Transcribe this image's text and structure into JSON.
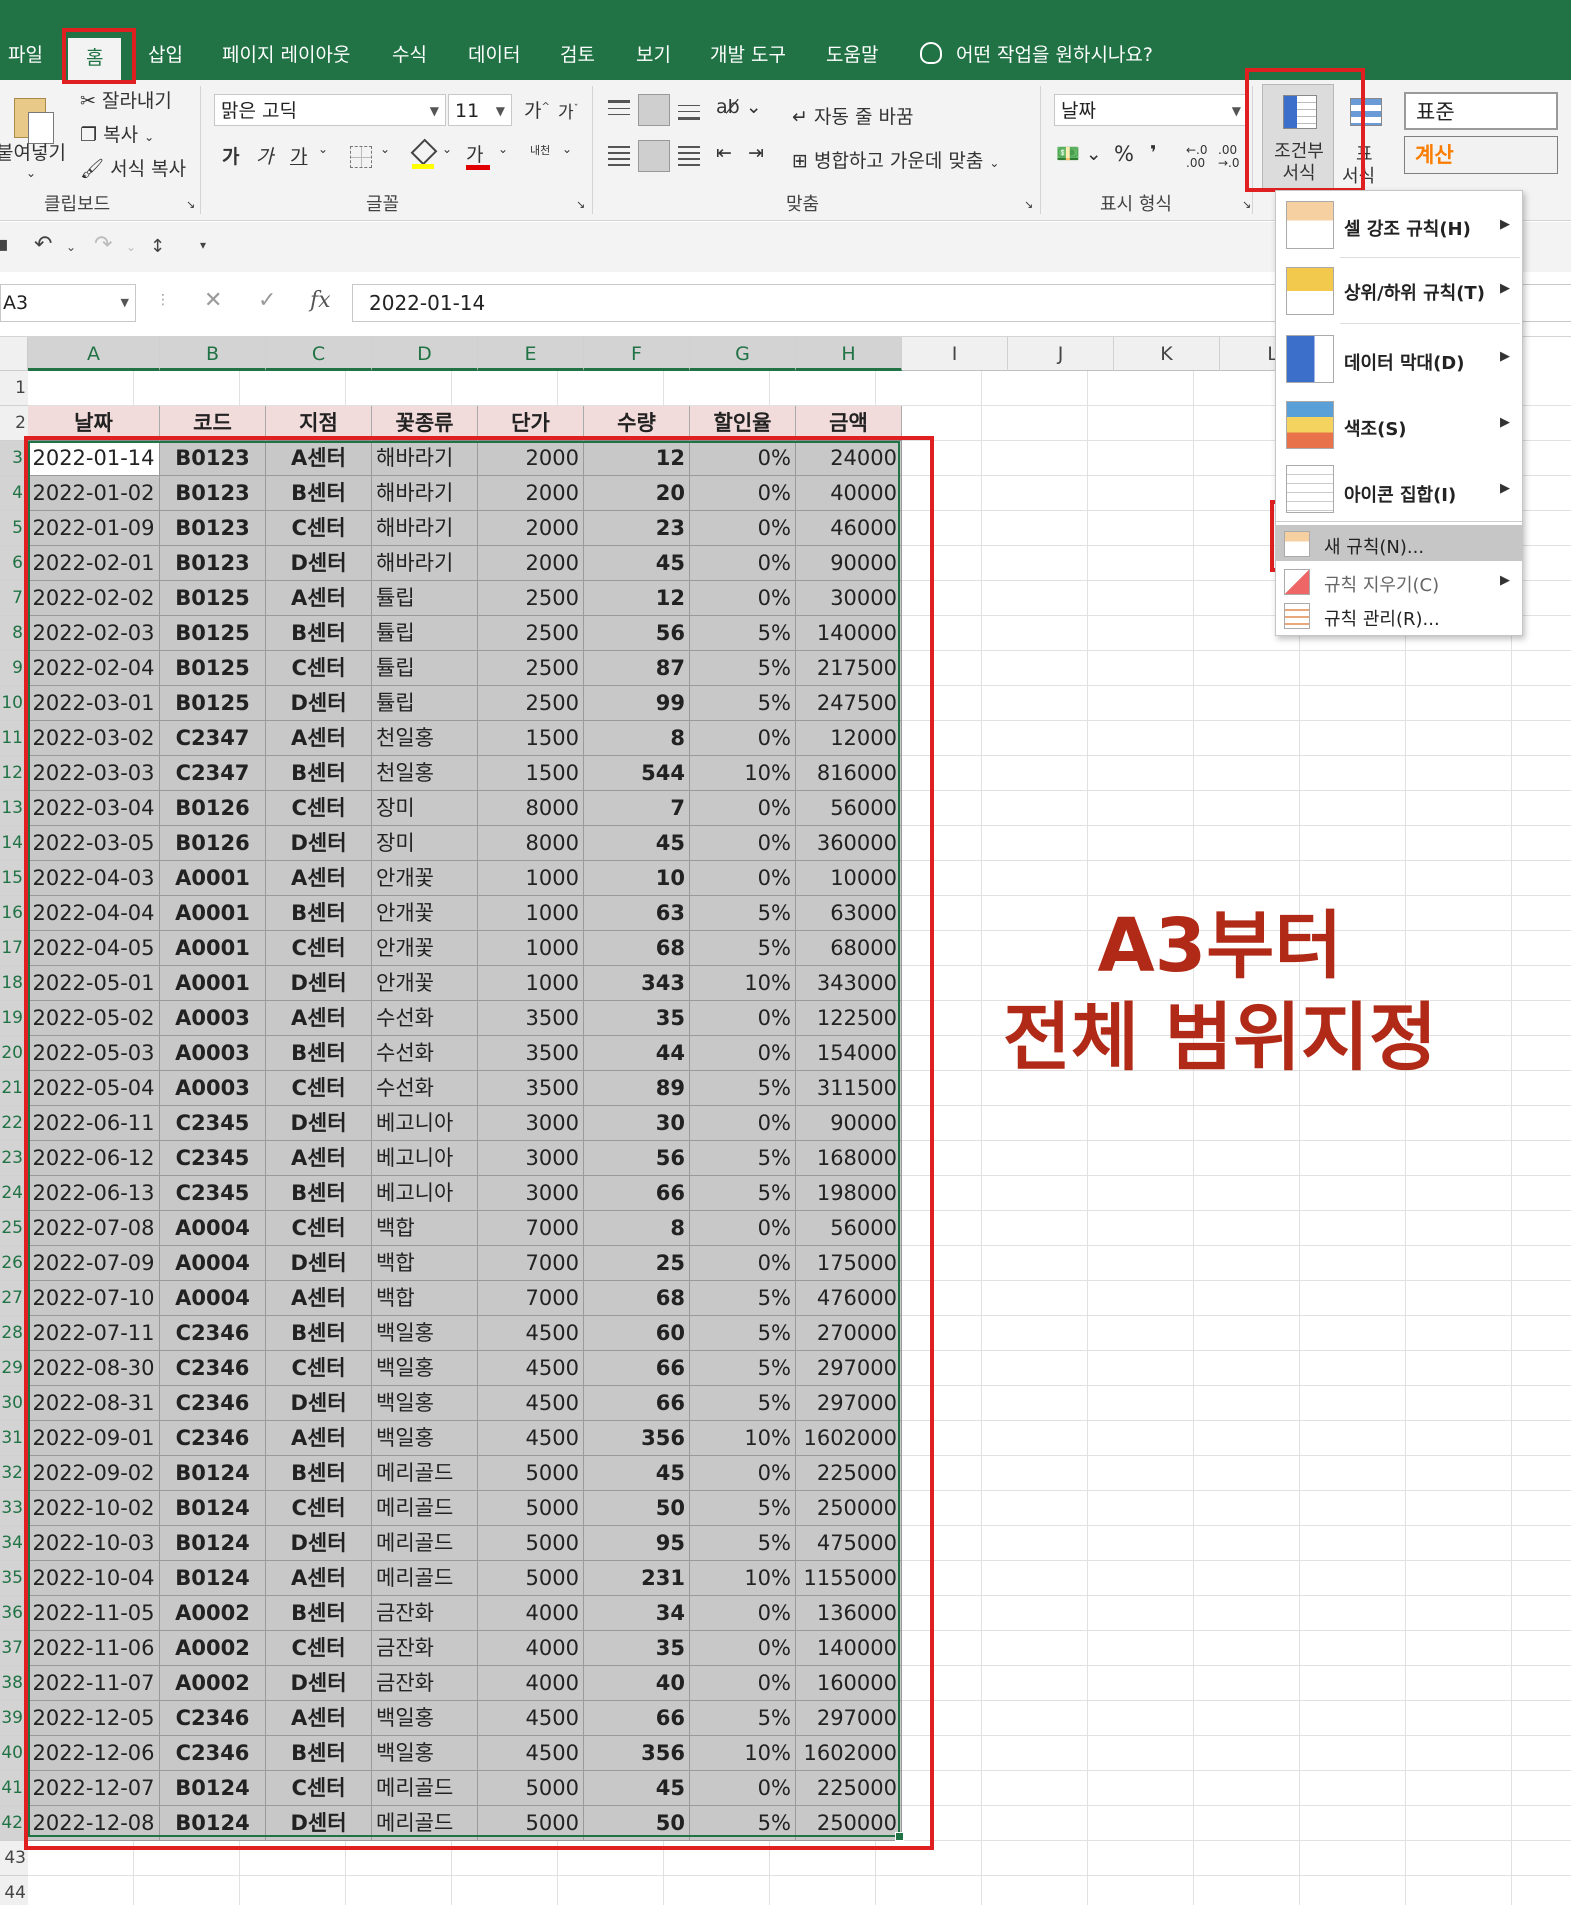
{
  "ribbon_tabs": [
    "파일",
    "홈",
    "삽입",
    "페이지 레이아웃",
    "수식",
    "데이터",
    "검토",
    "보기",
    "개발 도구",
    "도움말"
  ],
  "active_tab": "홈",
  "tell_me": "어떤 작업을 원하시나요?",
  "clipboard": {
    "paste": "붙여넣기",
    "cut": "잘라내기",
    "copy": "복사",
    "format_painter": "서식 복사",
    "group_label": "클립보드"
  },
  "font": {
    "name": "맑은 고딕",
    "size": "11",
    "grow": "가",
    "shrink": "가",
    "bold": "가",
    "italic": "가",
    "underline": "가",
    "font_color_glyph": "가",
    "phonetic": "내천",
    "group_label": "글꼴"
  },
  "alignment": {
    "wrap_text": "자동 줄 바꿈",
    "merge_center": "병합하고 가운데 맞춤",
    "group_label": "맞춤"
  },
  "number": {
    "format": "날짜",
    "percent": "%",
    "comma": "❜",
    "inc_decimal": "←.0 .00",
    "dec_decimal": ".00 →.0",
    "group_label": "표시 형식"
  },
  "styles": {
    "conditional_line1": "조건부",
    "conditional_line2": "서식",
    "table_line1": "표",
    "table_line2": "서식",
    "style_normal": "표준",
    "style_calc": "계산"
  },
  "formula_bar": {
    "name_box": "A3",
    "cancel": "✕",
    "enter": "✓",
    "fx": "fx",
    "value": "2022-01-14"
  },
  "columns": [
    "A",
    "B",
    "C",
    "D",
    "E",
    "F",
    "G",
    "H",
    "I",
    "J",
    "K",
    "L"
  ],
  "row_numbers": [
    "1",
    "2",
    "3",
    "4",
    "5",
    "6",
    "7",
    "8",
    "9",
    "10",
    "11",
    "12",
    "13",
    "14",
    "15",
    "16",
    "17",
    "18",
    "19",
    "20",
    "21",
    "22",
    "23",
    "24",
    "25",
    "26",
    "27",
    "28",
    "29",
    "30",
    "31",
    "32",
    "33",
    "34",
    "35",
    "36",
    "37",
    "38",
    "39",
    "40",
    "41",
    "42",
    "43",
    "44"
  ],
  "table": {
    "headers": [
      "날짜",
      "코드",
      "지점",
      "꽃종류",
      "단가",
      "수량",
      "할인율",
      "금액"
    ],
    "rows": [
      [
        "2022-01-14",
        "B0123",
        "A센터",
        "해바라기",
        "2000",
        "12",
        "0%",
        "24000"
      ],
      [
        "2022-01-02",
        "B0123",
        "B센터",
        "해바라기",
        "2000",
        "20",
        "0%",
        "40000"
      ],
      [
        "2022-01-09",
        "B0123",
        "C센터",
        "해바라기",
        "2000",
        "23",
        "0%",
        "46000"
      ],
      [
        "2022-02-01",
        "B0123",
        "D센터",
        "해바라기",
        "2000",
        "45",
        "0%",
        "90000"
      ],
      [
        "2022-02-02",
        "B0125",
        "A센터",
        "튤립",
        "2500",
        "12",
        "0%",
        "30000"
      ],
      [
        "2022-02-03",
        "B0125",
        "B센터",
        "튤립",
        "2500",
        "56",
        "5%",
        "140000"
      ],
      [
        "2022-02-04",
        "B0125",
        "C센터",
        "튤립",
        "2500",
        "87",
        "5%",
        "217500"
      ],
      [
        "2022-03-01",
        "B0125",
        "D센터",
        "튤립",
        "2500",
        "99",
        "5%",
        "247500"
      ],
      [
        "2022-03-02",
        "C2347",
        "A센터",
        "천일홍",
        "1500",
        "8",
        "0%",
        "12000"
      ],
      [
        "2022-03-03",
        "C2347",
        "B센터",
        "천일홍",
        "1500",
        "544",
        "10%",
        "816000"
      ],
      [
        "2022-03-04",
        "B0126",
        "C센터",
        "장미",
        "8000",
        "7",
        "0%",
        "56000"
      ],
      [
        "2022-03-05",
        "B0126",
        "D센터",
        "장미",
        "8000",
        "45",
        "0%",
        "360000"
      ],
      [
        "2022-04-03",
        "A0001",
        "A센터",
        "안개꽃",
        "1000",
        "10",
        "0%",
        "10000"
      ],
      [
        "2022-04-04",
        "A0001",
        "B센터",
        "안개꽃",
        "1000",
        "63",
        "5%",
        "63000"
      ],
      [
        "2022-04-05",
        "A0001",
        "C센터",
        "안개꽃",
        "1000",
        "68",
        "5%",
        "68000"
      ],
      [
        "2022-05-01",
        "A0001",
        "D센터",
        "안개꽃",
        "1000",
        "343",
        "10%",
        "343000"
      ],
      [
        "2022-05-02",
        "A0003",
        "A센터",
        "수선화",
        "3500",
        "35",
        "0%",
        "122500"
      ],
      [
        "2022-05-03",
        "A0003",
        "B센터",
        "수선화",
        "3500",
        "44",
        "0%",
        "154000"
      ],
      [
        "2022-05-04",
        "A0003",
        "C센터",
        "수선화",
        "3500",
        "89",
        "5%",
        "311500"
      ],
      [
        "2022-06-11",
        "C2345",
        "D센터",
        "베고니아",
        "3000",
        "30",
        "0%",
        "90000"
      ],
      [
        "2022-06-12",
        "C2345",
        "A센터",
        "베고니아",
        "3000",
        "56",
        "5%",
        "168000"
      ],
      [
        "2022-06-13",
        "C2345",
        "B센터",
        "베고니아",
        "3000",
        "66",
        "5%",
        "198000"
      ],
      [
        "2022-07-08",
        "A0004",
        "C센터",
        "백합",
        "7000",
        "8",
        "0%",
        "56000"
      ],
      [
        "2022-07-09",
        "A0004",
        "D센터",
        "백합",
        "7000",
        "25",
        "0%",
        "175000"
      ],
      [
        "2022-07-10",
        "A0004",
        "A센터",
        "백합",
        "7000",
        "68",
        "5%",
        "476000"
      ],
      [
        "2022-07-11",
        "C2346",
        "B센터",
        "백일홍",
        "4500",
        "60",
        "5%",
        "270000"
      ],
      [
        "2022-08-30",
        "C2346",
        "C센터",
        "백일홍",
        "4500",
        "66",
        "5%",
        "297000"
      ],
      [
        "2022-08-31",
        "C2346",
        "D센터",
        "백일홍",
        "4500",
        "66",
        "5%",
        "297000"
      ],
      [
        "2022-09-01",
        "C2346",
        "A센터",
        "백일홍",
        "4500",
        "356",
        "10%",
        "1602000"
      ],
      [
        "2022-09-02",
        "B0124",
        "B센터",
        "메리골드",
        "5000",
        "45",
        "0%",
        "225000"
      ],
      [
        "2022-10-02",
        "B0124",
        "C센터",
        "메리골드",
        "5000",
        "50",
        "5%",
        "250000"
      ],
      [
        "2022-10-03",
        "B0124",
        "D센터",
        "메리골드",
        "5000",
        "95",
        "5%",
        "475000"
      ],
      [
        "2022-10-04",
        "B0124",
        "A센터",
        "메리골드",
        "5000",
        "231",
        "10%",
        "1155000"
      ],
      [
        "2022-11-05",
        "A0002",
        "B센터",
        "금잔화",
        "4000",
        "34",
        "0%",
        "136000"
      ],
      [
        "2022-11-06",
        "A0002",
        "C센터",
        "금잔화",
        "4000",
        "35",
        "0%",
        "140000"
      ],
      [
        "2022-11-07",
        "A0002",
        "D센터",
        "금잔화",
        "4000",
        "40",
        "0%",
        "160000"
      ],
      [
        "2022-12-05",
        "C2346",
        "A센터",
        "백일홍",
        "4500",
        "66",
        "5%",
        "297000"
      ],
      [
        "2022-12-06",
        "C2346",
        "B센터",
        "백일홍",
        "4500",
        "356",
        "10%",
        "1602000"
      ],
      [
        "2022-12-07",
        "B0124",
        "C센터",
        "메리골드",
        "5000",
        "45",
        "0%",
        "225000"
      ],
      [
        "2022-12-08",
        "B0124",
        "D센터",
        "메리골드",
        "5000",
        "50",
        "5%",
        "250000"
      ]
    ]
  },
  "cf_menu": {
    "items": [
      {
        "label": "셀 강조 규칙(H)",
        "icon": "highlight-cells-icon",
        "submenu": true
      },
      {
        "label": "상위/하위 규칙(T)",
        "icon": "top-bottom-icon",
        "submenu": true
      },
      {
        "label": "데이터 막대(D)",
        "icon": "data-bars-icon",
        "submenu": true
      },
      {
        "label": "색조(S)",
        "icon": "color-scales-icon",
        "submenu": true
      },
      {
        "label": "아이콘 집합(I)",
        "icon": "icon-sets-icon",
        "submenu": true
      }
    ],
    "small_items": [
      {
        "label": "새 규칙(N)...",
        "icon": "new-rule-icon",
        "highlighted": true
      },
      {
        "label": "규칙 지우기(C)",
        "icon": "clear-rules-icon",
        "submenu": true
      },
      {
        "label": "규칙 관리(R)...",
        "icon": "manage-rules-icon"
      }
    ]
  },
  "annotation": {
    "line1": "A3부터",
    "line2": "전체 범위지정"
  },
  "colors": {
    "excel_green": "#217346",
    "header_fill": "#f2dcdb",
    "selection_fill": "#c8c8c8",
    "annotation_red": "#e02020",
    "annotation_text": "#b02a17"
  }
}
